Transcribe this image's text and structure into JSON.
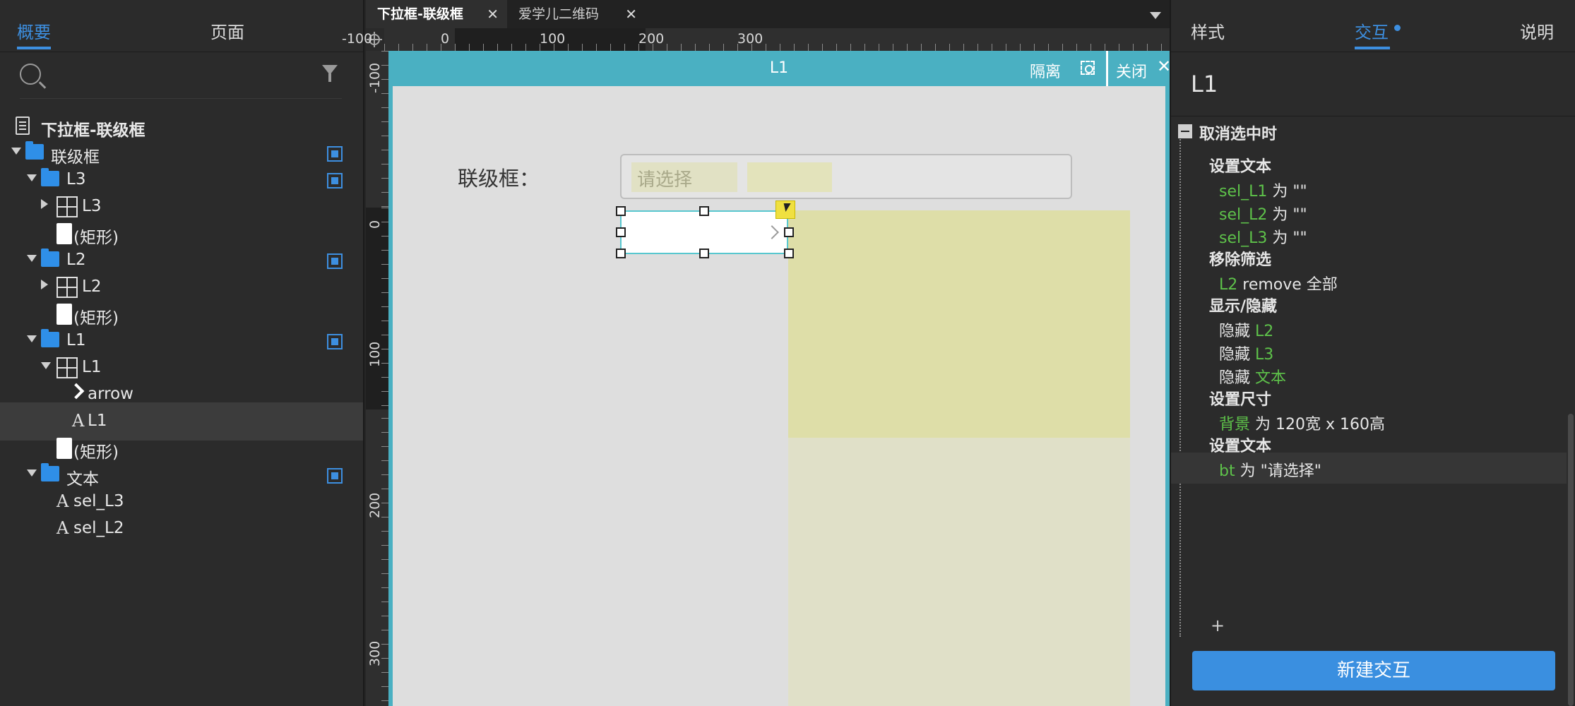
{
  "left_panel": {
    "tabs": [
      "概要",
      "页面"
    ],
    "page_name": "下拉框-联级框",
    "tree": [
      {
        "label": "联级框",
        "type": "folder",
        "level": 0,
        "caret": "down",
        "dynamic": true
      },
      {
        "label": "L3",
        "type": "folder",
        "level": 1,
        "caret": "down",
        "dynamic": true
      },
      {
        "label": "L3",
        "type": "repeater",
        "level": 2,
        "caret": "right"
      },
      {
        "label": "(矩形)",
        "type": "rect",
        "level": 2
      },
      {
        "label": "L2",
        "type": "folder",
        "level": 1,
        "caret": "down",
        "dynamic": true
      },
      {
        "label": "L2",
        "type": "repeater",
        "level": 2,
        "caret": "right"
      },
      {
        "label": "(矩形)",
        "type": "rect",
        "level": 2
      },
      {
        "label": "L1",
        "type": "folder",
        "level": 1,
        "caret": "down",
        "dynamic": true
      },
      {
        "label": "L1",
        "type": "repeater",
        "level": 2,
        "caret": "down"
      },
      {
        "label": "arrow",
        "type": "chevron",
        "level": 3
      },
      {
        "label": "L1",
        "type": "text",
        "level": 3,
        "selected": true
      },
      {
        "label": "(矩形)",
        "type": "rect",
        "level": 2
      },
      {
        "label": "文本",
        "type": "folder",
        "level": 1,
        "caret": "down",
        "dynamic": true
      },
      {
        "label": "sel_L3",
        "type": "text",
        "level": 2
      },
      {
        "label": "sel_L2",
        "type": "text",
        "level": 2
      }
    ]
  },
  "doc_tabs": [
    {
      "label": "下拉框-联级框",
      "active": true
    },
    {
      "label": "爱学儿二维码",
      "active": false
    }
  ],
  "rulers": {
    "horizontal": [
      "-100",
      "0",
      "100",
      "200",
      "300"
    ],
    "vertical": [
      "-100",
      "0",
      "100",
      "200",
      "300"
    ]
  },
  "isolation_bar": {
    "title": "L1",
    "isolate_label": "隔离",
    "close_label": "关闭",
    "color": "#4ab0c2"
  },
  "canvas": {
    "combo_label": "联级框：",
    "combo_placeholder": "请选择"
  },
  "right_panel": {
    "tabs": [
      "样式",
      "交互",
      "说明"
    ],
    "widget_name": "L1",
    "event": "取消选中时",
    "actions": [
      {
        "head": "设置文本",
        "items": [
          [
            {
              "t": "sel_L1",
              "g": true
            },
            {
              "t": " 为 \"\""
            }
          ],
          [
            {
              "t": "sel_L2",
              "g": true
            },
            {
              "t": " 为 \"\""
            }
          ],
          [
            {
              "t": "sel_L3",
              "g": true
            },
            {
              "t": " 为 \"\""
            }
          ]
        ]
      },
      {
        "head": "移除筛选",
        "items": [
          [
            {
              "t": "L2",
              "g": true
            },
            {
              "t": " remove 全部"
            }
          ]
        ]
      },
      {
        "head": "显示/隐藏",
        "items": [
          [
            {
              "t": "隐藏 "
            },
            {
              "t": "L2",
              "g": true
            }
          ],
          [
            {
              "t": "隐藏 "
            },
            {
              "t": "L3",
              "g": true
            }
          ],
          [
            {
              "t": "隐藏 "
            },
            {
              "t": "文本",
              "g": true
            }
          ]
        ]
      },
      {
        "head": "设置尺寸",
        "items": [
          [
            {
              "t": "背景",
              "g": true
            },
            {
              "t": " 为 120宽 x 160高"
            }
          ]
        ]
      },
      {
        "head": "设置文本",
        "items": [
          [
            {
              "t": "bt",
              "g": true
            },
            {
              "t": " 为 \"请选择\""
            }
          ]
        ]
      }
    ],
    "add_label": "+",
    "new_interaction": "新建交互",
    "accent_color": "#3d8fe0",
    "target_color": "#5ec24a"
  }
}
